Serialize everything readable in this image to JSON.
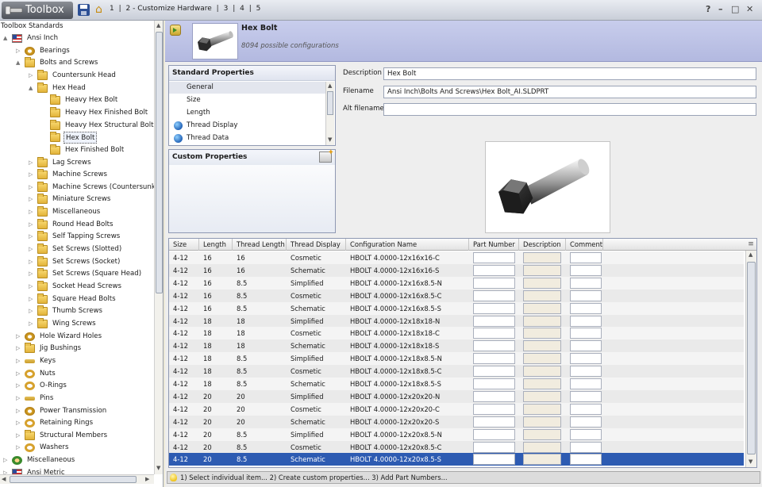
{
  "titlebar": {
    "logo": "Toolbox",
    "nav": [
      "1",
      "|",
      "2 - Customize Hardware",
      "|",
      "3",
      "|",
      "4",
      "|",
      "5"
    ],
    "controls": [
      "?",
      "–",
      "□",
      "✕"
    ]
  },
  "tree": {
    "root_label": "Toolbox Standards",
    "items": [
      {
        "label": "Ansi Inch",
        "indent": 0,
        "icon": "flag",
        "tri": "▲"
      },
      {
        "label": "Bearings",
        "indent": 1,
        "icon": "gear",
        "tri": "▷"
      },
      {
        "label": "Bolts and Screws",
        "indent": 1,
        "icon": "folder",
        "tri": "▲"
      },
      {
        "label": "Countersunk Head",
        "indent": 2,
        "icon": "folder",
        "tri": "▷"
      },
      {
        "label": "Hex Head",
        "indent": 2,
        "icon": "folder",
        "tri": "▲"
      },
      {
        "label": "Heavy Hex Bolt",
        "indent": 3,
        "icon": "folder",
        "tri": ""
      },
      {
        "label": "Heavy Hex Finished Bolt",
        "indent": 3,
        "icon": "folder",
        "tri": ""
      },
      {
        "label": "Heavy Hex Structural Bolt",
        "indent": 3,
        "icon": "folder",
        "tri": ""
      },
      {
        "label": "Hex Bolt",
        "indent": 3,
        "icon": "folder",
        "tri": "",
        "selected": true
      },
      {
        "label": "Hex Finished Bolt",
        "indent": 3,
        "icon": "folder",
        "tri": ""
      },
      {
        "label": "Lag Screws",
        "indent": 2,
        "icon": "folder",
        "tri": "▷"
      },
      {
        "label": "Machine Screws",
        "indent": 2,
        "icon": "folder",
        "tri": "▷"
      },
      {
        "label": "Machine Screws (Countersunk)",
        "indent": 2,
        "icon": "folder",
        "tri": "▷"
      },
      {
        "label": "Miniature Screws",
        "indent": 2,
        "icon": "folder",
        "tri": "▷"
      },
      {
        "label": "Miscellaneous",
        "indent": 2,
        "icon": "folder",
        "tri": "▷"
      },
      {
        "label": "Round Head Bolts",
        "indent": 2,
        "icon": "folder",
        "tri": "▷"
      },
      {
        "label": "Self Tapping Screws",
        "indent": 2,
        "icon": "folder",
        "tri": "▷"
      },
      {
        "label": "Set Screws (Slotted)",
        "indent": 2,
        "icon": "folder",
        "tri": "▷"
      },
      {
        "label": "Set Screws (Socket)",
        "indent": 2,
        "icon": "folder",
        "tri": "▷"
      },
      {
        "label": "Set Screws (Square Head)",
        "indent": 2,
        "icon": "folder",
        "tri": "▷"
      },
      {
        "label": "Socket Head Screws",
        "indent": 2,
        "icon": "folder",
        "tri": "▷"
      },
      {
        "label": "Square Head Bolts",
        "indent": 2,
        "icon": "folder",
        "tri": "▷"
      },
      {
        "label": "Thumb Screws",
        "indent": 2,
        "icon": "folder",
        "tri": "▷"
      },
      {
        "label": "Wing Screws",
        "indent": 2,
        "icon": "folder",
        "tri": "▷"
      },
      {
        "label": "Hole Wizard Holes",
        "indent": 1,
        "icon": "gear",
        "tri": "▷"
      },
      {
        "label": "Jig Bushings",
        "indent": 1,
        "icon": "folder",
        "tri": "▷"
      },
      {
        "label": "Keys",
        "indent": 1,
        "icon": "key",
        "tri": "▷"
      },
      {
        "label": "Nuts",
        "indent": 1,
        "icon": "ring",
        "tri": "▷"
      },
      {
        "label": "O-Rings",
        "indent": 1,
        "icon": "ring",
        "tri": "▷"
      },
      {
        "label": "Pins",
        "indent": 1,
        "icon": "key",
        "tri": "▷"
      },
      {
        "label": "Power Transmission",
        "indent": 1,
        "icon": "gear",
        "tri": "▷"
      },
      {
        "label": "Retaining Rings",
        "indent": 1,
        "icon": "ring",
        "tri": "▷"
      },
      {
        "label": "Structural Members",
        "indent": 1,
        "icon": "folder",
        "tri": "▷"
      },
      {
        "label": "Washers",
        "indent": 1,
        "icon": "ring",
        "tri": "▷"
      },
      {
        "label": "Miscellaneous",
        "indent": 0,
        "icon": "person",
        "tri": "▷"
      },
      {
        "label": "Ansi Metric",
        "indent": 0,
        "icon": "flag",
        "tri": "▷"
      }
    ]
  },
  "header": {
    "title": "Hex Bolt",
    "subtitle": "8094 possible configurations"
  },
  "standard_properties": {
    "title": "Standard Properties",
    "items": [
      {
        "label": "General",
        "globe": false,
        "selected": true
      },
      {
        "label": "Size",
        "globe": false
      },
      {
        "label": "Length",
        "globe": false
      },
      {
        "label": "Thread Display",
        "globe": true
      },
      {
        "label": "Thread Data",
        "globe": true
      }
    ]
  },
  "custom_properties": {
    "title": "Custom Properties"
  },
  "fields": {
    "description_label": "Description",
    "description_value": "Hex Bolt",
    "filename_label": "Filename",
    "filename_value": "Ansi Inch\\Bolts And Screws\\Hex Bolt_AI.SLDPRT",
    "alt_filename_label": "Alt filename",
    "alt_filename_value": ""
  },
  "grid": {
    "columns": [
      "Size",
      "Length",
      "Thread Length",
      "Thread Display",
      "Configuration Name",
      "Part Number",
      "Description",
      "Comment"
    ],
    "rows": [
      [
        "4-12",
        "16",
        "16",
        "Cosmetic",
        "HBOLT 4.0000-12x16x16-C"
      ],
      [
        "4-12",
        "16",
        "16",
        "Schematic",
        "HBOLT 4.0000-12x16x16-S"
      ],
      [
        "4-12",
        "16",
        "8.5",
        "Simplified",
        "HBOLT 4.0000-12x16x8.5-N"
      ],
      [
        "4-12",
        "16",
        "8.5",
        "Cosmetic",
        "HBOLT 4.0000-12x16x8.5-C"
      ],
      [
        "4-12",
        "16",
        "8.5",
        "Schematic",
        "HBOLT 4.0000-12x16x8.5-S"
      ],
      [
        "4-12",
        "18",
        "18",
        "Simplified",
        "HBOLT 4.0000-12x18x18-N"
      ],
      [
        "4-12",
        "18",
        "18",
        "Cosmetic",
        "HBOLT 4.0000-12x18x18-C"
      ],
      [
        "4-12",
        "18",
        "18",
        "Schematic",
        "HBOLT 4.0000-12x18x18-S"
      ],
      [
        "4-12",
        "18",
        "8.5",
        "Simplified",
        "HBOLT 4.0000-12x18x8.5-N"
      ],
      [
        "4-12",
        "18",
        "8.5",
        "Cosmetic",
        "HBOLT 4.0000-12x18x8.5-C"
      ],
      [
        "4-12",
        "18",
        "8.5",
        "Schematic",
        "HBOLT 4.0000-12x18x8.5-S"
      ],
      [
        "4-12",
        "20",
        "20",
        "Simplified",
        "HBOLT 4.0000-12x20x20-N"
      ],
      [
        "4-12",
        "20",
        "20",
        "Cosmetic",
        "HBOLT 4.0000-12x20x20-C"
      ],
      [
        "4-12",
        "20",
        "20",
        "Schematic",
        "HBOLT 4.0000-12x20x20-S"
      ],
      [
        "4-12",
        "20",
        "8.5",
        "Simplified",
        "HBOLT 4.0000-12x20x8.5-N"
      ],
      [
        "4-12",
        "20",
        "8.5",
        "Cosmetic",
        "HBOLT 4.0000-12x20x8.5-C"
      ],
      [
        "4-12",
        "20",
        "8.5",
        "Schematic",
        "HBOLT 4.0000-12x20x8.5-S"
      ]
    ],
    "selected_row": 16
  },
  "status": {
    "text": "1) Select individual item... 2) Create custom properties... 3) Add Part Numbers..."
  },
  "colors": {
    "header_bg": "#b9bfe4",
    "selection": "#2d5bb2",
    "description_cell": "#f1ecdf"
  }
}
